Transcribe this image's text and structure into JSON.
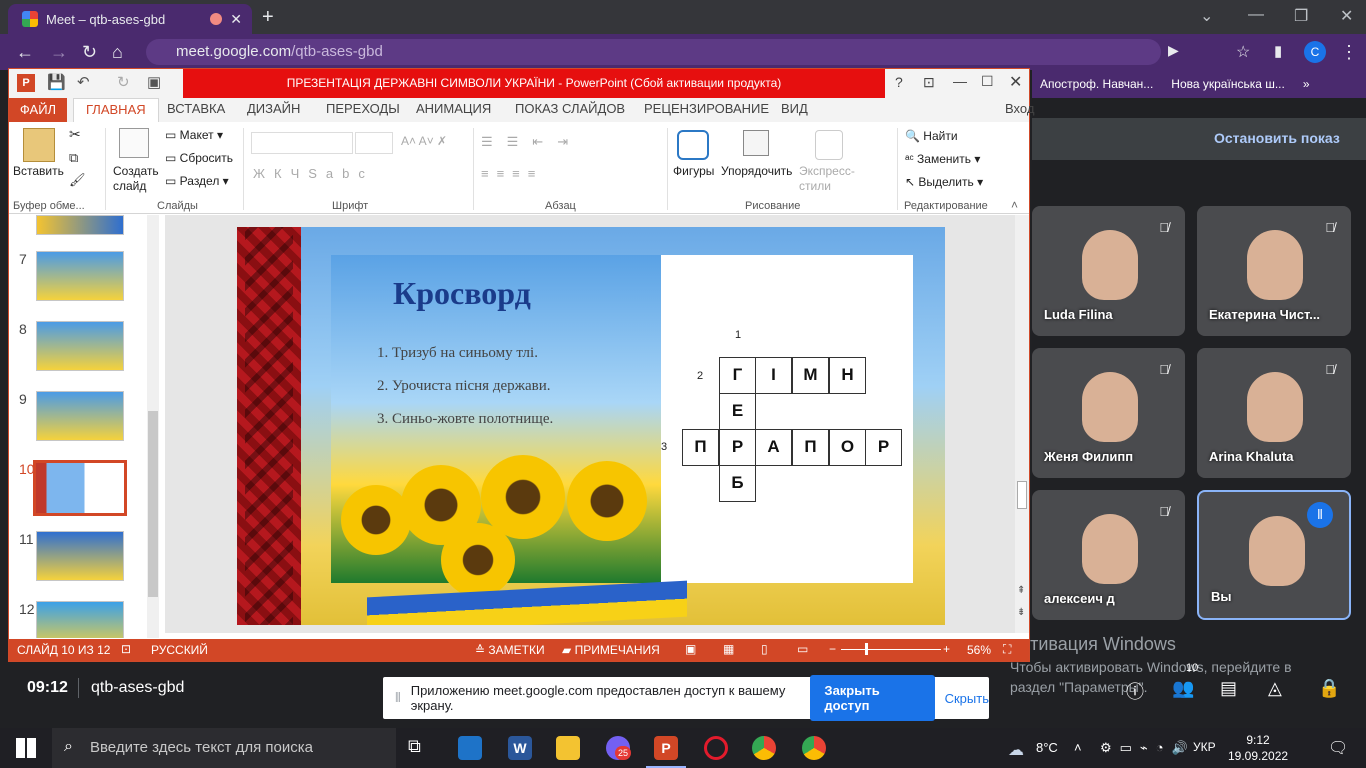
{
  "browser": {
    "tab_title": "Meet – qtb-ases-gbd",
    "url_host": "meet.google.com",
    "url_path": "/qtb-ases-gbd",
    "profile_letter": "C",
    "bookmarks": [
      "Апостроф. Навчан...",
      "Нова українська ш..."
    ]
  },
  "ppt": {
    "title": "ПРЕЗЕНТАЦІЯ  ДЕРЖАВНІ СИМВОЛИ УКРАЇНИ -  PowerPoint (Сбой активации продукта)",
    "sign_in": "Вход",
    "tabs": [
      "ФАЙЛ",
      "ГЛАВНАЯ",
      "ВСТАВКА",
      "ДИЗАЙН",
      "ПЕРЕХОДЫ",
      "АНИМАЦИЯ",
      "ПОКАЗ СЛАЙДОВ",
      "РЕЦЕНЗИРОВАНИЕ",
      "ВИД"
    ],
    "ribbon": {
      "paste": "Вставить",
      "new_slide": "Создать слайд",
      "layout": "Макет",
      "reset": "Сбросить",
      "section": "Раздел",
      "shapes": "Фигуры",
      "arrange": "Упорядочить",
      "quick_styles": "Экспресс-стили",
      "find": "Найти",
      "replace": "Заменить",
      "select": "Выделить",
      "groups": [
        "Буфер обме...",
        "Слайды",
        "Шрифт",
        "Абзац",
        "Рисование",
        "Редактирование"
      ]
    },
    "thumb_numbers": [
      "7",
      "8",
      "9",
      "10",
      "11",
      "12"
    ],
    "slide": {
      "title": "Кросворд",
      "clues": [
        "1.   Тризуб на синьому тлі.",
        "2.   Урочиста пісня держави.",
        "3.    Синьо-жовте полотнище."
      ],
      "numbers": [
        "1",
        "2",
        "3"
      ],
      "row_gimn": [
        "Г",
        "І",
        "М",
        "Н"
      ],
      "col_e": "Е",
      "row_prapor": [
        "П",
        "Р",
        "А",
        "П",
        "О",
        "Р"
      ],
      "col_b": "Б"
    },
    "status": {
      "slide_info": "СЛАЙД 10 ИЗ 12",
      "lang": "РУССКИЙ",
      "notes": "ЗАМЕТКИ",
      "comments": "ПРИМЕЧАНИЯ",
      "zoom": "56%"
    }
  },
  "meet": {
    "stop_show": "Остановить показ",
    "participants": [
      "Luda Filina",
      "Екатерина Чист...",
      "Женя Филипп",
      "Arina Khaluta",
      "алексеич д",
      "Вы"
    ],
    "time": "09:12",
    "code": "qtb-ases-gbd",
    "people_count": "10",
    "activation_title": "Активация Windows",
    "activation_text": "Чтобы активировать Windows, перейдите в раздел \"Параметры\".",
    "share_notice": "Приложению meet.google.com предоставлен доступ к вашему экрану.",
    "share_stop": "Закрыть доступ",
    "share_hide": "Скрыть"
  },
  "taskbar": {
    "search_placeholder": "Введите здесь текст для поиска",
    "temp": "8°C",
    "lang": "УКР",
    "time": "9:12",
    "date": "19.09.2022",
    "viber_badge": "25"
  }
}
